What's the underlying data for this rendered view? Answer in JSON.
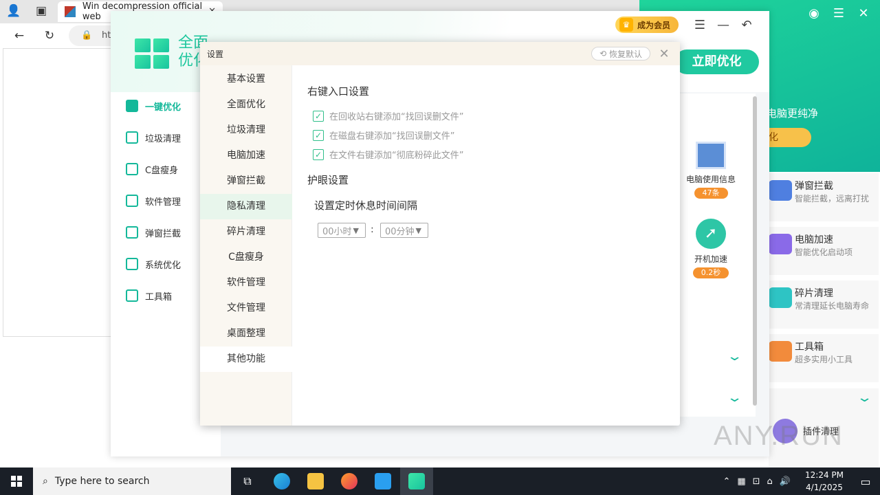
{
  "browser": {
    "tab_title": "Win decompression official web",
    "address_text": "ht"
  },
  "right_app": {
    "slogan": "电脑更纯净",
    "opt_label": "化",
    "features": [
      {
        "title": "弹窗拦截",
        "subtitle": "智能拦截，远离打扰",
        "icon": "ad-block-icon"
      },
      {
        "title": "电脑加速",
        "subtitle": "智能优化启动项",
        "icon": "rocket-icon"
      },
      {
        "title": "碎片清理",
        "subtitle": "常清理延长电脑寿命",
        "icon": "fragment-icon"
      },
      {
        "title": "工具箱",
        "subtitle": "超多实用小工具",
        "icon": "toolbox-icon"
      }
    ],
    "plugin_title": "插件清理",
    "watermark": "ANY.RUN"
  },
  "main_app": {
    "logo_text": "全面优化",
    "vip_label": "成为会员",
    "optimize_label": "立即优化",
    "sidebar": [
      {
        "label": "一键优化",
        "icon": "grid-icon",
        "active": true
      },
      {
        "label": "垃圾清理",
        "icon": "trash-icon",
        "active": false
      },
      {
        "label": "C盘瘦身",
        "icon": "disk-icon",
        "active": false
      },
      {
        "label": "软件管理",
        "icon": "apps-icon",
        "active": false
      },
      {
        "label": "弹窗拦截",
        "icon": "block-icon",
        "active": false
      },
      {
        "label": "系统优化",
        "icon": "system-icon",
        "active": false
      },
      {
        "label": "工具箱",
        "icon": "toolbox-icon",
        "active": false
      }
    ],
    "tiles": [
      {
        "title": "电脑使用信息",
        "badge": "47条"
      },
      {
        "title": "开机加速",
        "badge": "0.2秒"
      }
    ]
  },
  "settings_dialog": {
    "title": "设置",
    "restore_label": "恢复默认",
    "nav": [
      "基本设置",
      "全面优化",
      "垃圾清理",
      "电脑加速",
      "弹窗拦截",
      "隐私清理",
      "碎片清理",
      "C盘瘦身",
      "软件管理",
      "文件管理",
      "桌面整理",
      "其他功能"
    ],
    "hovered_nav": "隐私清理",
    "selected_nav": "其他功能",
    "context_menu_section": "右键入口设置",
    "checkboxes": [
      {
        "label": "在回收站右键添加“找回误删文件”",
        "checked": true
      },
      {
        "label": "在磁盘右键添加“找回误删文件”",
        "checked": true
      },
      {
        "label": "在文件右键添加“彻底粉碎此文件”",
        "checked": true
      }
    ],
    "eye_section": "护眼设置",
    "rest_interval_label": "设置定时休息时间间隔",
    "hours_value": "00小时",
    "minutes_value": "00分钟",
    "colon": ":"
  },
  "taskbar": {
    "search_placeholder": "Type here to search",
    "time": "12:24 PM",
    "date": "4/1/2025"
  }
}
